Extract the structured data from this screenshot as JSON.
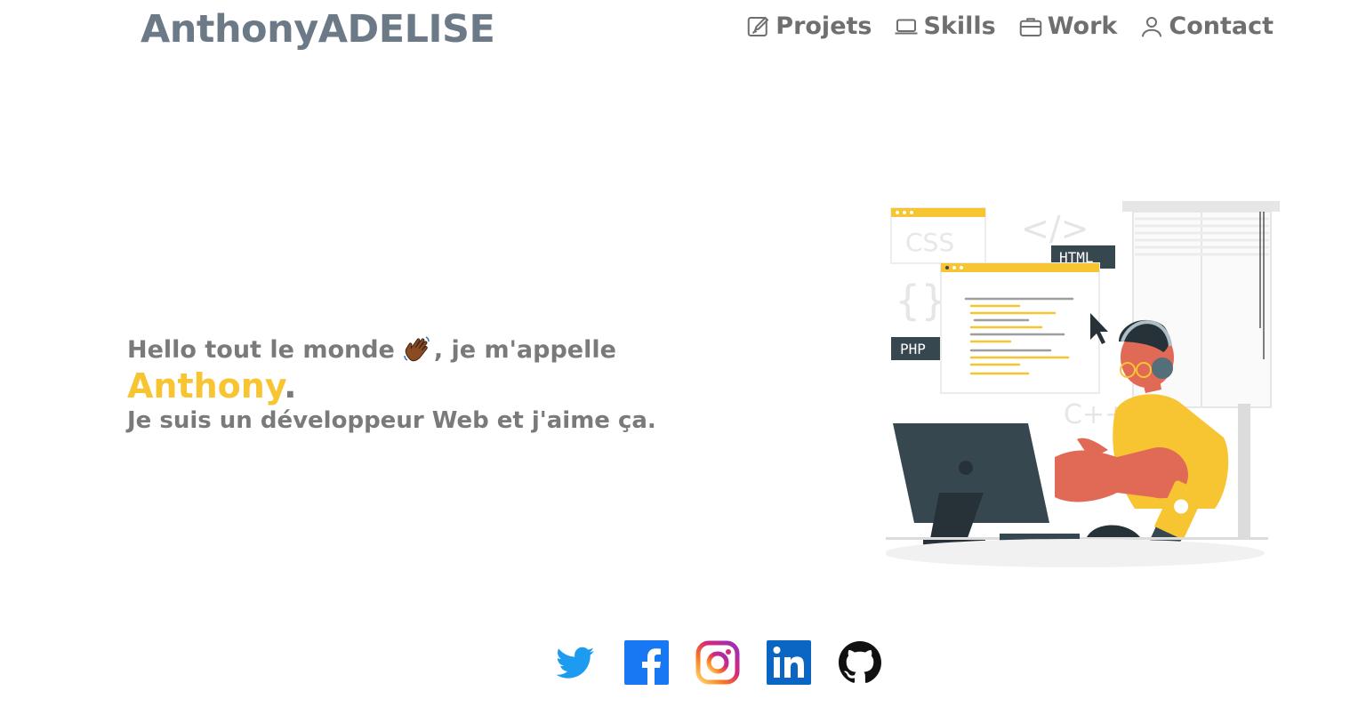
{
  "header": {
    "logo": "AnthonyADELISE",
    "nav": [
      {
        "label": "Projets",
        "icon": "pencil-square-icon"
      },
      {
        "label": "Skills",
        "icon": "laptop-icon"
      },
      {
        "label": "Work",
        "icon": "briefcase-icon"
      },
      {
        "label": "Contact",
        "icon": "person-icon"
      }
    ]
  },
  "hero": {
    "greeting_before": "Hello tout le monde ",
    "greeting_after": ", je m'appelle",
    "name": "Anthony",
    "name_suffix": ".",
    "tagline": "Je suis un développeur Web et j'aime ça.",
    "wave_icon": "waving-hand-icon"
  },
  "illustration": {
    "labels": {
      "css": "CSS",
      "html": "HTML",
      "php": "PHP",
      "cpp": "C++",
      "code_tag": "</>",
      "braces": "{}"
    }
  },
  "socials": [
    {
      "name": "Twitter",
      "icon": "twitter-icon"
    },
    {
      "name": "Facebook",
      "icon": "facebook-icon"
    },
    {
      "name": "Instagram",
      "icon": "instagram-icon"
    },
    {
      "name": "LinkedIn",
      "icon": "linkedin-icon"
    },
    {
      "name": "GitHub",
      "icon": "github-icon"
    }
  ],
  "colors": {
    "accent": "#f7c531",
    "text": "#7a7a7a",
    "logo": "#6c7a88"
  }
}
